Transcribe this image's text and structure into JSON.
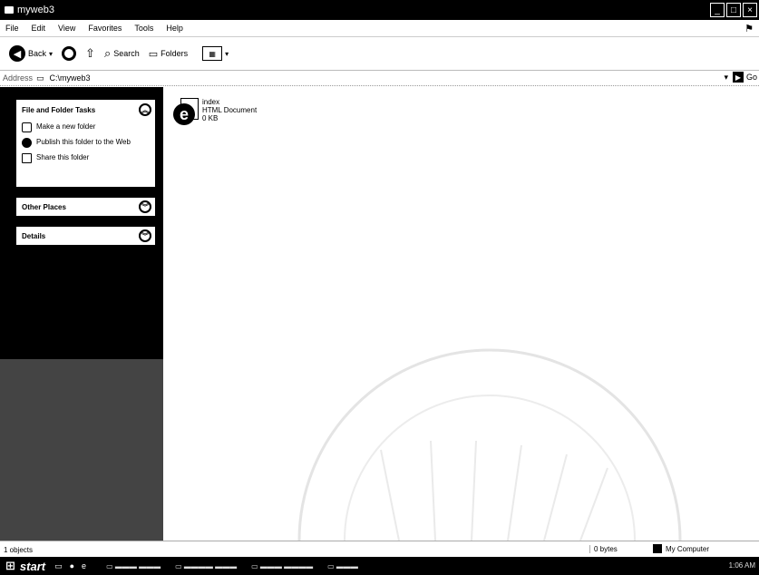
{
  "window": {
    "title": "myweb3"
  },
  "menu": [
    "File",
    "Edit",
    "View",
    "Favorites",
    "Tools",
    "Help"
  ],
  "toolbar": {
    "back_label": "Back",
    "search_label": "Search",
    "folders_label": "Folders"
  },
  "address": {
    "label": "Address",
    "path": "C:\\myweb3",
    "go_label": "Go"
  },
  "tasks_panel": {
    "title": "File and Folder Tasks",
    "items": [
      "Make a new folder",
      "Publish this folder to the Web",
      "Share this folder"
    ]
  },
  "other_places": {
    "title": "Other Places"
  },
  "details": {
    "title": "Details"
  },
  "files": [
    {
      "name": "index",
      "type": "HTML Document",
      "size": "0 KB"
    }
  ],
  "status": {
    "count": "1 objects",
    "size": "0 bytes",
    "zone": "My Computer"
  },
  "taskbar": {
    "start_label": "start",
    "tray_time": "1:06 AM"
  }
}
